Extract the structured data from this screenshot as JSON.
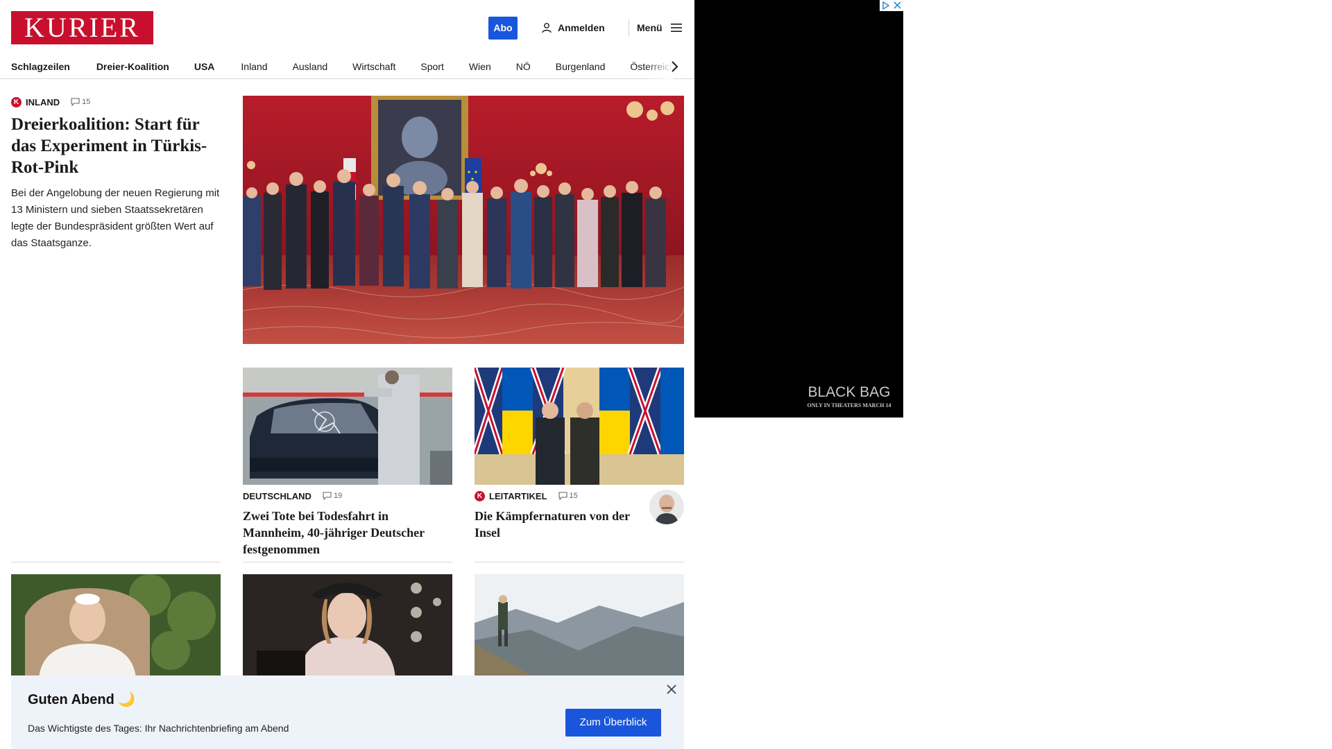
{
  "header": {
    "logo": "KURIER",
    "abo_label": "Abo",
    "login_label": "Anmelden",
    "menu_label": "Menü"
  },
  "nav": {
    "items": [
      "Schlagzeilen",
      "Dreier-Koalition",
      "USA",
      "Inland",
      "Ausland",
      "Wirtschaft",
      "Sport",
      "Wien",
      "NÖ",
      "Burgenland",
      "Österreich"
    ]
  },
  "lead": {
    "category": "INLAND",
    "comments": "15",
    "title": "Dreierkoalition: Start für das Experiment in Türkis-Rot-Pink",
    "teaser": "Bei der Angelobung der neuen Regierung mit 13 Ministern und sieben Staatssekretären legte der Bundespräsident größten Wert auf das Staatsganze."
  },
  "cards": [
    {
      "category": "DEUTSCHLAND",
      "comments": "19",
      "title": "Zwei Tote bei Todesfahrt in Mannheim, 40-jähriger Deutscher festgenommen"
    },
    {
      "category": "LEITARTIKEL",
      "comments": "15",
      "title": "Die Kämpfernaturen von der Insel"
    }
  ],
  "banner": {
    "title": "Guten Abend 🌙",
    "text": "Das Wichtigste des Tages: Ihr Nachrichtenbriefing am Abend",
    "button": "Zum Überblick"
  },
  "ad": {
    "title": "BLACK BAG",
    "subtitle": "ONLY IN THEATERS MARCH 14"
  },
  "colors": {
    "brand_red": "#c8102e",
    "accent_blue": "#1a56db",
    "banner_bg": "#eef2f9"
  }
}
